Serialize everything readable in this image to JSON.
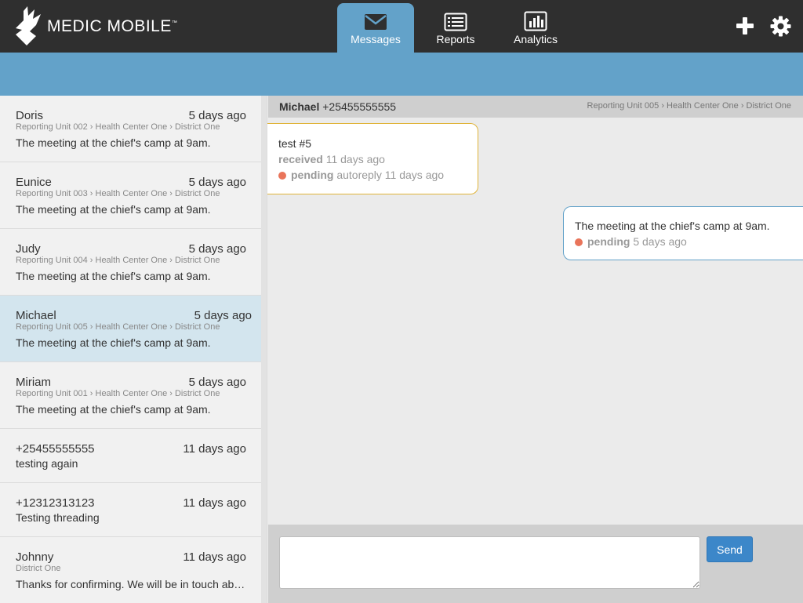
{
  "brand": {
    "name": "MEDIC MOBILE",
    "tm": "™"
  },
  "nav": {
    "tabs": [
      {
        "label": "Messages",
        "icon": "envelope-icon",
        "active": true
      },
      {
        "label": "Reports",
        "icon": "list-icon",
        "active": false
      },
      {
        "label": "Analytics",
        "icon": "bar-chart-icon",
        "active": false
      }
    ],
    "actions": [
      "plus-icon",
      "gear-icon"
    ]
  },
  "colors": {
    "topbar": "#2f2f2f",
    "accent": "#63a2c9",
    "send": "#3c87c9",
    "pending_dot": "#e9745a",
    "incoming_border": "#e0b43a"
  },
  "messages": [
    {
      "name": "Doris",
      "time": "5 days ago",
      "place": "Reporting Unit 002 › Health Center One › District One",
      "text": "The meeting at the chief's camp at 9am."
    },
    {
      "name": "Eunice",
      "time": "5 days ago",
      "place": "Reporting Unit 003 › Health Center One › District One",
      "text": "The meeting at the chief's camp at 9am."
    },
    {
      "name": "Judy",
      "time": "5 days ago",
      "place": "Reporting Unit 004 › Health Center One › District One",
      "text": "The meeting at the chief's camp at 9am."
    },
    {
      "name": "Michael",
      "time": "5 days ago",
      "place": "Reporting Unit 005 › Health Center One › District One",
      "text": "The meeting at the chief's camp at 9am.",
      "selected": true
    },
    {
      "name": "Miriam",
      "time": "5 days ago",
      "place": "Reporting Unit 001 › Health Center One › District One",
      "text": "The meeting at the chief's camp at 9am."
    },
    {
      "name": "+25455555555",
      "time": "11 days ago",
      "place": "",
      "text": "testing again"
    },
    {
      "name": "+12312313123",
      "time": "11 days ago",
      "place": "",
      "text": "Testing threading"
    },
    {
      "name": "Johnny",
      "time": "11 days ago",
      "place": "District One",
      "text": "Thanks for confirming. We will be in touch ab…"
    }
  ],
  "conversation": {
    "contact_name": "Michael",
    "contact_phone": "+25455555555",
    "place": "Reporting Unit 005 › Health Center One › District One",
    "incoming": {
      "text": "test #5",
      "status1_label": "received",
      "status1_time": "11 days ago",
      "status2_label": "pending",
      "status2_time": "autoreply 11 days ago"
    },
    "outgoing": {
      "text": "The meeting at the chief's camp at 9am.",
      "status_label": "pending",
      "status_time": "5 days ago"
    },
    "composer": {
      "placeholder": "",
      "send_label": "Send"
    }
  }
}
